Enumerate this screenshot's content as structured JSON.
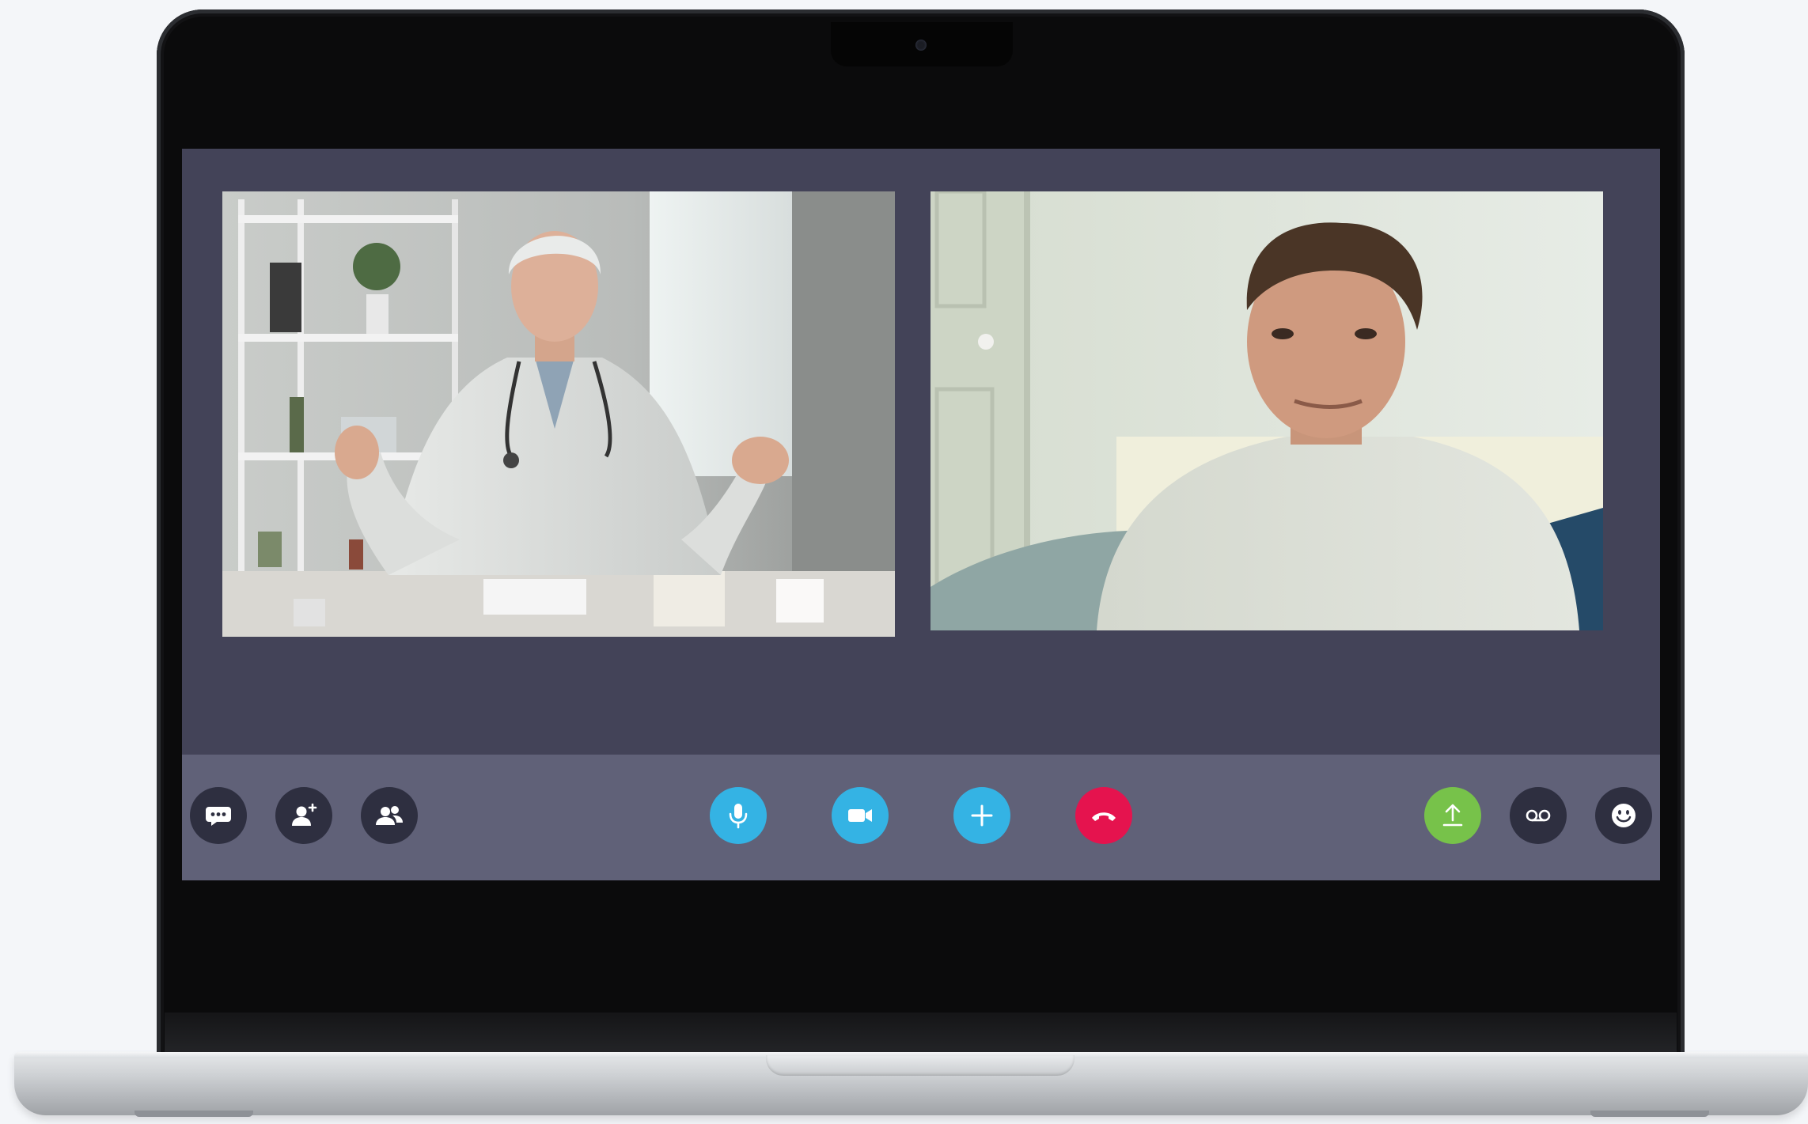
{
  "window": {
    "title": ""
  },
  "participants": [
    {
      "name": "",
      "role": "doctor"
    },
    {
      "name": "",
      "role": "patient"
    }
  ],
  "controls": {
    "left": [
      {
        "id": "chat",
        "icon": "chat-bubble-icon"
      },
      {
        "id": "add-contact",
        "icon": "add-person-icon"
      },
      {
        "id": "participants",
        "icon": "people-icon"
      }
    ],
    "center": [
      {
        "id": "microphone",
        "icon": "microphone-icon",
        "color": "#34b3e4"
      },
      {
        "id": "camera",
        "icon": "video-camera-icon",
        "color": "#34b3e4"
      },
      {
        "id": "add",
        "icon": "plus-icon",
        "color": "#34b3e4"
      },
      {
        "id": "hang-up",
        "icon": "phone-hangup-icon",
        "color": "#e5134e"
      }
    ],
    "right": [
      {
        "id": "share",
        "icon": "upload-icon",
        "color": "#77c24a"
      },
      {
        "id": "voicemail",
        "icon": "voicemail-icon"
      },
      {
        "id": "emoji",
        "icon": "smiley-icon"
      }
    ]
  },
  "colors": {
    "app_background": "#434358",
    "toolbar_background": "#606178",
    "dark_button": "#2e2f40",
    "accent_blue": "#34b3e4",
    "hangup_red": "#e5134e",
    "share_green": "#77c24a"
  }
}
